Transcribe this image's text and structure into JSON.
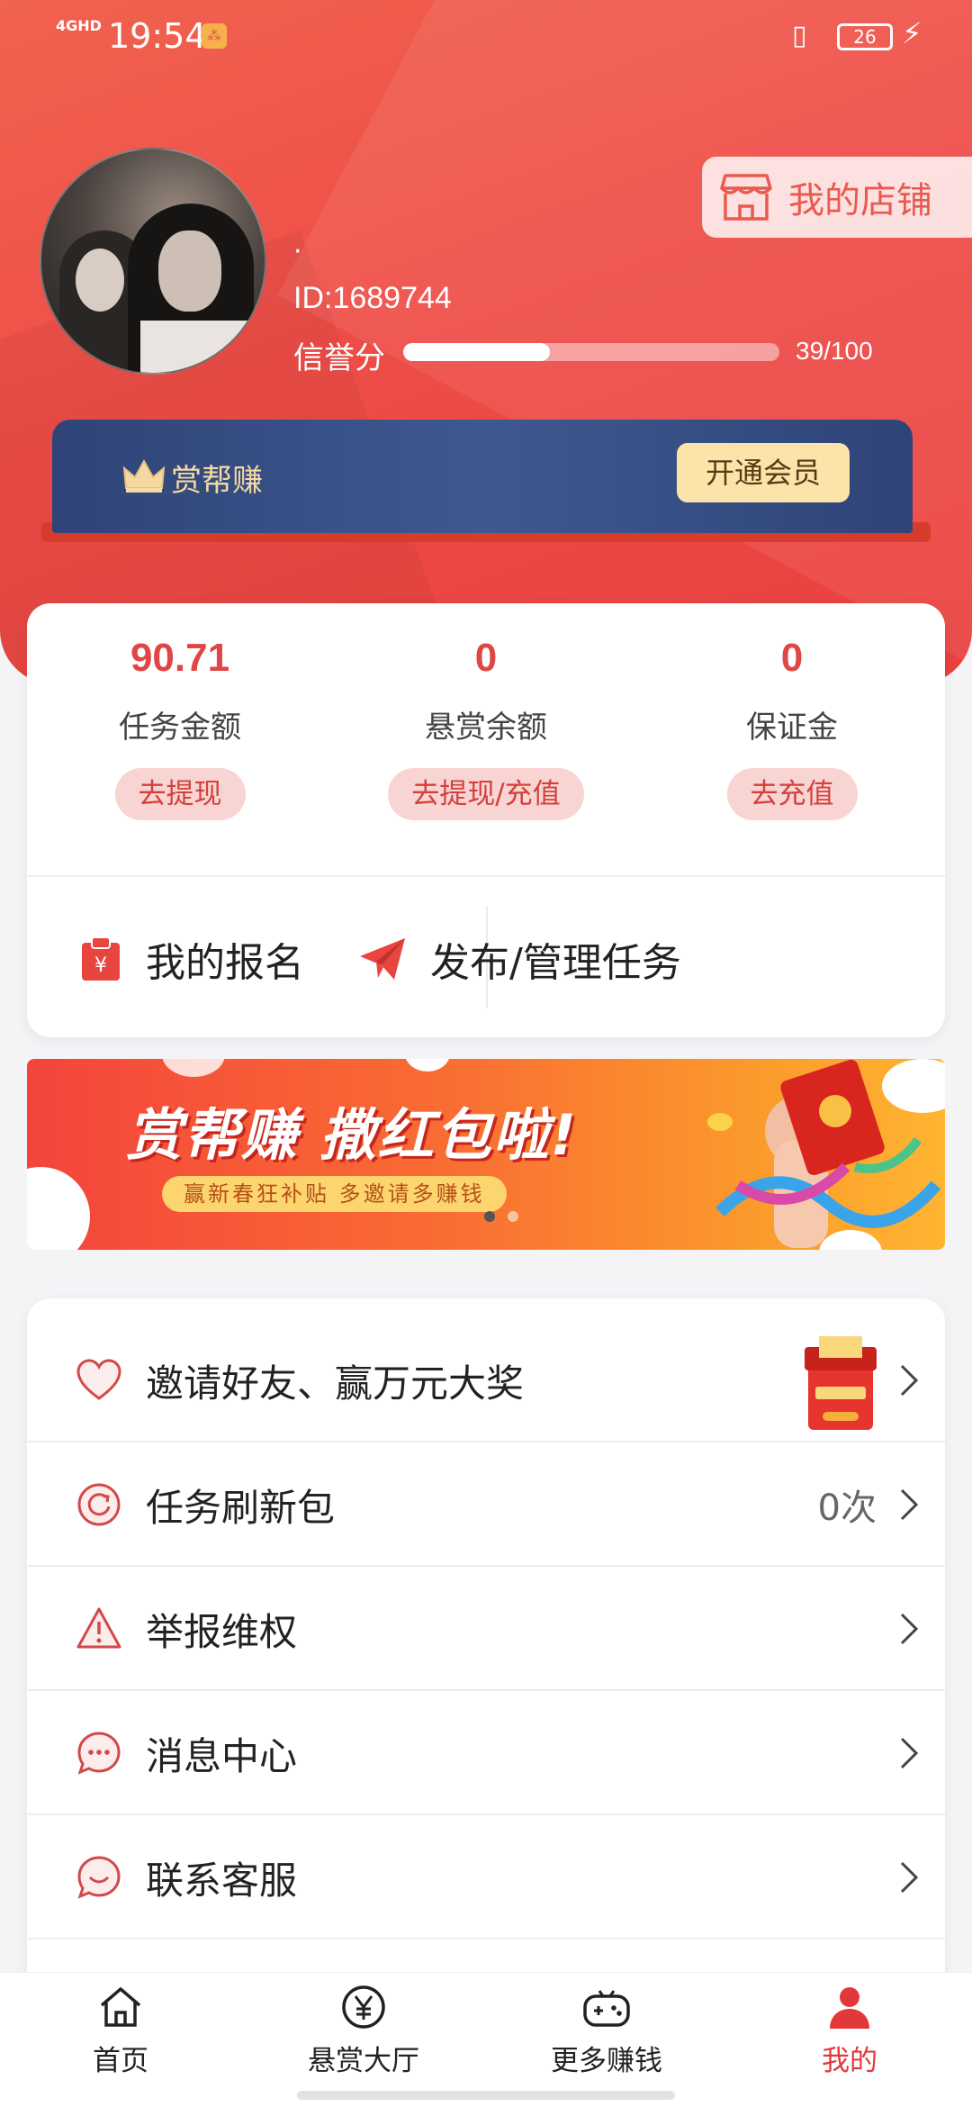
{
  "status_bar": {
    "network": "4GHD",
    "time": "19:54",
    "battery": "26"
  },
  "profile": {
    "nickname": "·",
    "user_id": "ID:1689744",
    "credit_label": "信誉分",
    "credit_value": "39/100",
    "credit_fraction": 0.39,
    "shop_label": "我的店铺"
  },
  "vip": {
    "brand": "赏帮赚",
    "open_button": "开通会员"
  },
  "wallet": {
    "items": [
      {
        "amount": "90.71",
        "label": "任务金额",
        "action": "去提现"
      },
      {
        "amount": "0",
        "label": "悬赏余额",
        "action": "去提现/充值"
      },
      {
        "amount": "0",
        "label": "保证金",
        "action": "去充值"
      }
    ],
    "my_signup": "我的报名",
    "publish": "发布/管理任务"
  },
  "promo": {
    "headline": "赏帮赚 撒红包啦!",
    "subline": "赢新春狂补贴 多邀请多赚钱"
  },
  "menu": {
    "items": [
      {
        "label": "邀请好友、赢万元大奖",
        "value": "",
        "icon": "heart-icon"
      },
      {
        "label": "任务刷新包",
        "value": "0次",
        "icon": "refresh-icon"
      },
      {
        "label": "举报维权",
        "value": "",
        "icon": "warning-icon"
      },
      {
        "label": "消息中心",
        "value": "",
        "icon": "chat-icon"
      },
      {
        "label": "联系客服",
        "value": "",
        "icon": "smile-icon"
      }
    ]
  },
  "tabbar": {
    "items": [
      {
        "label": "首页",
        "icon": "home-icon"
      },
      {
        "label": "悬赏大厅",
        "icon": "yen-icon"
      },
      {
        "label": "更多赚钱",
        "icon": "gamepad-icon"
      },
      {
        "label": "我的",
        "icon": "person-icon"
      }
    ],
    "active": 3
  },
  "colors": {
    "brand_red": "#ee4d47",
    "vip_navy": "#34497f",
    "accent_amount": "#e04646"
  }
}
